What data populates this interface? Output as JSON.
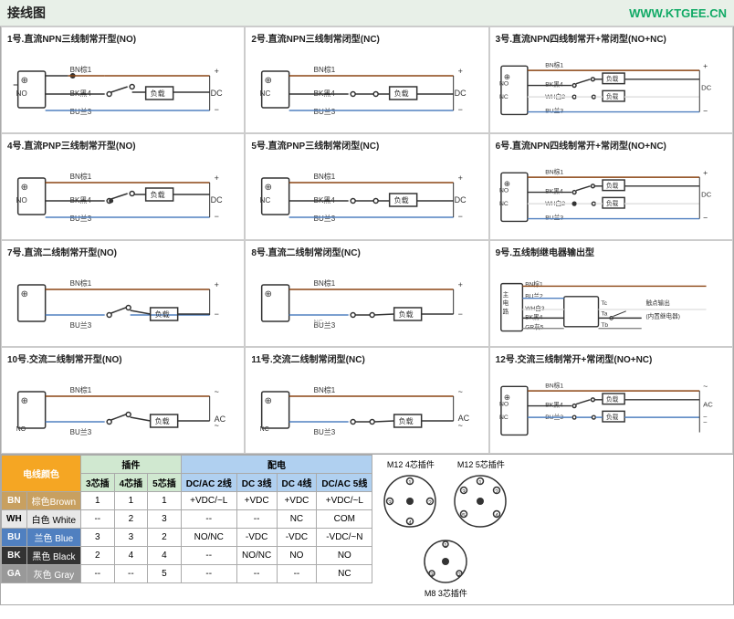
{
  "header": {
    "title": "接线图",
    "url": "WWW.KTGEE.CN"
  },
  "diagrams": [
    {
      "id": 1,
      "title": "1号.直流NPN三线制常开型(NO)",
      "type": "npn3-no"
    },
    {
      "id": 2,
      "title": "2号.直流NPN三线制常闭型(NC)",
      "type": "npn3-nc"
    },
    {
      "id": 3,
      "title": "3号.直流NPN四线制常开+常闭型(NO+NC)",
      "type": "npn4-nonc"
    },
    {
      "id": 4,
      "title": "4号.直流PNP三线制常开型(NO)",
      "type": "pnp3-no"
    },
    {
      "id": 5,
      "title": "5号.直流PNP三线制常闭型(NC)",
      "type": "pnp3-nc"
    },
    {
      "id": 6,
      "title": "6号.直流NPN四线制常开+常闭型(NO+NC)",
      "type": "npn4-nonc2"
    },
    {
      "id": 7,
      "title": "7号.直流二线制常开型(NO)",
      "type": "dc2-no"
    },
    {
      "id": 8,
      "title": "8号.直流二线制常闭型(NC)",
      "type": "dc2-nc"
    },
    {
      "id": 9,
      "title": "9号.五线制继电器输出型",
      "type": "relay5"
    },
    {
      "id": 10,
      "title": "10号.交流二线制常开型(NO)",
      "type": "ac2-no"
    },
    {
      "id": 11,
      "title": "11号.交流二线制常闭型(NC)",
      "type": "ac2-nc"
    },
    {
      "id": 12,
      "title": "12号.交流三线制常开+常闭型(NO+NC)",
      "type": "ac3-nonc"
    }
  ],
  "table": {
    "header_color": "电线颜色",
    "header_plugin": "插件",
    "header_power": "配电",
    "col_plugin": [
      "3芯插",
      "4芯插",
      "5芯插"
    ],
    "col_power": [
      "DC/AC 2线",
      "DC 3线",
      "DC 4线",
      "DC/AC 5线"
    ],
    "rows": [
      {
        "code": "BN",
        "name": "棕色Brown",
        "color_class": "color-bn",
        "plugin": [
          "1",
          "1",
          "1"
        ],
        "power": [
          "+VDC/~L",
          "+VDC",
          "+VDC",
          "+VDC/~L"
        ]
      },
      {
        "code": "WH",
        "name": "白色 White",
        "color_class": "color-wh",
        "plugin": [
          "--",
          "2",
          "3"
        ],
        "power": [
          "--",
          "--",
          "NC",
          "COM"
        ]
      },
      {
        "code": "BU",
        "name": "兰色 Blue",
        "color_class": "color-bu",
        "plugin": [
          "3",
          "3",
          "2"
        ],
        "power": [
          "NO/NC",
          "-VDC",
          "-VDC",
          "-VDC/~N"
        ]
      },
      {
        "code": "BK",
        "name": "黑色 Black",
        "color_class": "color-bk",
        "plugin": [
          "2",
          "4",
          "4"
        ],
        "power": [
          "--",
          "NO/NC",
          "NO",
          "NO"
        ]
      },
      {
        "code": "GA",
        "name": "灰色 Gray",
        "color_class": "color-ga",
        "plugin": [
          "--",
          "--",
          "5"
        ],
        "power": [
          "--",
          "--",
          "--",
          "NC"
        ]
      }
    ]
  },
  "connectors": {
    "m12_4_label": "M12 4芯插件",
    "m12_5_label": "M12 5芯插件",
    "m8_3_label": "M8 3芯插件"
  }
}
